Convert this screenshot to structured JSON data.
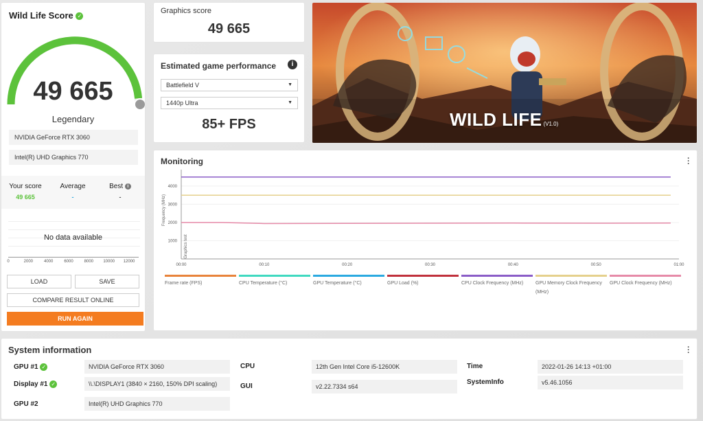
{
  "score_card": {
    "title": "Wild Life Score",
    "score": "49 665",
    "tier": "Legendary",
    "gauge_fraction": 0.97,
    "devices": [
      "NVIDIA GeForce RTX 3060",
      "Intel(R) UHD Graphics 770"
    ],
    "comparison": {
      "your_label": "Your score",
      "your_value": "49 665",
      "avg_label": "Average",
      "avg_value": "-",
      "best_label": "Best",
      "best_value": "-"
    },
    "histogram_empty": "No data available",
    "histogram_ticks": [
      "0",
      "2000",
      "4000",
      "6000",
      "8000",
      "10000",
      "12000"
    ],
    "buttons": {
      "load": "LOAD",
      "save": "SAVE",
      "compare": "COMPARE RESULT ONLINE",
      "run": "RUN AGAIN"
    }
  },
  "graphics": {
    "label": "Graphics score",
    "value": "49 665"
  },
  "estimated": {
    "title": "Estimated game performance",
    "game": "Battlefield V",
    "preset": "1440p Ultra",
    "fps": "85+ FPS"
  },
  "banner": {
    "title": "WILD LIFE",
    "version": "(V1.0)"
  },
  "monitoring": {
    "title": "Monitoring",
    "y_axis_label": "Frequency (MHz)",
    "section_label": "Graphics test",
    "legend": [
      {
        "label": "Frame rate (FPS)",
        "color": "#e8833a"
      },
      {
        "label": "CPU Temperature (°C)",
        "color": "#3fd9c0"
      },
      {
        "label": "GPU Temperature (°C)",
        "color": "#2aa9e0"
      },
      {
        "label": "GPU Load (%)",
        "color": "#c0303b"
      },
      {
        "label": "CPU Clock Frequency (MHz)",
        "color": "#8a5cc7"
      },
      {
        "label": "GPU Memory Clock Frequency (MHz)",
        "color": "#e5d08c"
      },
      {
        "label": "GPU Clock Frequency (MHz)",
        "color": "#e68aa8"
      }
    ]
  },
  "chart_data": {
    "type": "line",
    "x_ticks": [
      "00:00",
      "00:10",
      "00:20",
      "00:30",
      "00:40",
      "00:50",
      "01:00"
    ],
    "y_ticks": [
      "1000",
      "2000",
      "3000",
      "4000"
    ],
    "ylim": [
      0,
      4600
    ],
    "xlim": [
      0,
      60
    ],
    "ylabel": "Frequency (MHz)",
    "series": [
      {
        "name": "CPU Clock Frequency (MHz)",
        "color": "#8a5cc7",
        "x": [
          0,
          59
        ],
        "values": [
          4500,
          4500
        ]
      },
      {
        "name": "GPU Memory Clock Frequency (MHz)",
        "color": "#e5d08c",
        "x": [
          0,
          59
        ],
        "values": [
          3500,
          3500
        ]
      },
      {
        "name": "GPU Clock Frequency (MHz)",
        "color": "#e68aa8",
        "x": [
          0,
          5,
          10,
          20,
          30,
          40,
          50,
          59
        ],
        "values": [
          2000,
          2000,
          1940,
          1950,
          1960,
          1970,
          1960,
          1970
        ]
      }
    ]
  },
  "system_info": {
    "title": "System information",
    "col1": [
      {
        "label": "GPU #1",
        "value": "NVIDIA GeForce RTX 3060",
        "check": true
      },
      {
        "label": "Display #1",
        "value": "\\\\.\\DISPLAY1 (3840 × 2160, 150% DPI scaling)",
        "check": true
      },
      {
        "label": "GPU #2",
        "value": "Intel(R) UHD Graphics 770",
        "check": false
      }
    ],
    "col2": [
      {
        "label": "CPU",
        "value": "12th Gen Intel Core i5-12600K"
      },
      {
        "label": "GUI",
        "value": "v2.22.7334 s64"
      }
    ],
    "col3": [
      {
        "label": "Time",
        "value": "2022-01-26 14:13 +01:00"
      },
      {
        "label": "SystemInfo",
        "value": "v5.46.1056"
      }
    ]
  }
}
